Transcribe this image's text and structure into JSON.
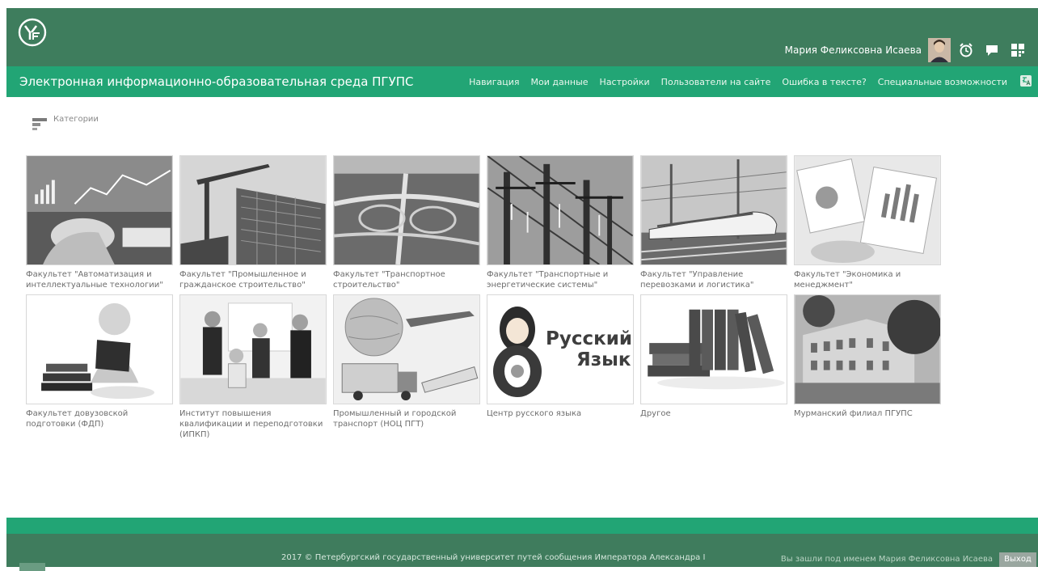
{
  "header": {
    "user_name": "Мария Феликсовна Исаева",
    "icons": [
      "university-logo",
      "avatar",
      "alarm-clock-icon",
      "chat-icon",
      "apps-grid-icon"
    ]
  },
  "nav": {
    "site_title": "Электронная информационно-образовательная среда ПГУПС",
    "items": [
      "Навигация",
      "Мои данные",
      "Настройки",
      "Пользователи на сайте",
      "Ошибка в тексте?",
      "Специальные возможности"
    ]
  },
  "breadcrumb": {
    "label": "Категории"
  },
  "categories": [
    {
      "label": "Факультет \"Автоматизация и интеллектуальные технологии\"",
      "image": "automation-thumbnail"
    },
    {
      "label": "Факультет \"Промышленное и гражданское строительство\"",
      "image": "construction-thumbnail"
    },
    {
      "label": "Факультет \"Транспортное строительство\"",
      "image": "highway-interchange-thumbnail"
    },
    {
      "label": "Факультет \"Транспортные и энергетические системы\"",
      "image": "power-lines-thumbnail"
    },
    {
      "label": "Факультет \"Управление перевозками и логистика\"",
      "image": "train-thumbnail"
    },
    {
      "label": "Факультет \"Экономика и менеджмент\"",
      "image": "economics-charts-thumbnail"
    },
    {
      "label": "Факультет довузовской подготовки (ФДП)",
      "image": "reading-figure-thumbnail"
    },
    {
      "label": "Институт повышения квалификации и переподготовки (ИПКП)",
      "image": "business-meeting-thumbnail"
    },
    {
      "label": "Промышленный и городской транспорт (НОЦ ПГТ)",
      "image": "transport-collage-thumbnail"
    },
    {
      "label": "Центр русского языка",
      "image": "russian-language-thumbnail",
      "image_text": [
        "Русский",
        "Язык"
      ]
    },
    {
      "label": "Другое",
      "image": "binders-thumbnail"
    },
    {
      "label": "Мурманский филиал ПГУПС",
      "image": "branch-building-thumbnail"
    }
  ],
  "footer": {
    "copyright": "2017 © Петербургский государственный университет путей сообщения Императора Александра I",
    "logged_in": "Вы зашли под именем Мария Феликсовна Исаева",
    "logout": "Выход"
  },
  "colors": {
    "header_dark": "#3e7d5d",
    "nav_green": "#22a575",
    "footer_dark": "#3f7c5d",
    "caption": "#6d6d6d"
  }
}
